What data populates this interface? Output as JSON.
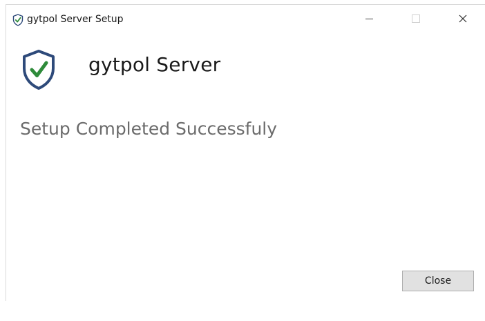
{
  "window": {
    "title": "gytpol Server Setup"
  },
  "header": {
    "product_name": "gytpol Server",
    "icon": "shield-check-icon"
  },
  "main": {
    "status": "Setup Completed Successfuly"
  },
  "footer": {
    "close_label": "Close"
  },
  "colors": {
    "shield_outline": "#2e4a7a",
    "check": "#2e8b3a"
  }
}
